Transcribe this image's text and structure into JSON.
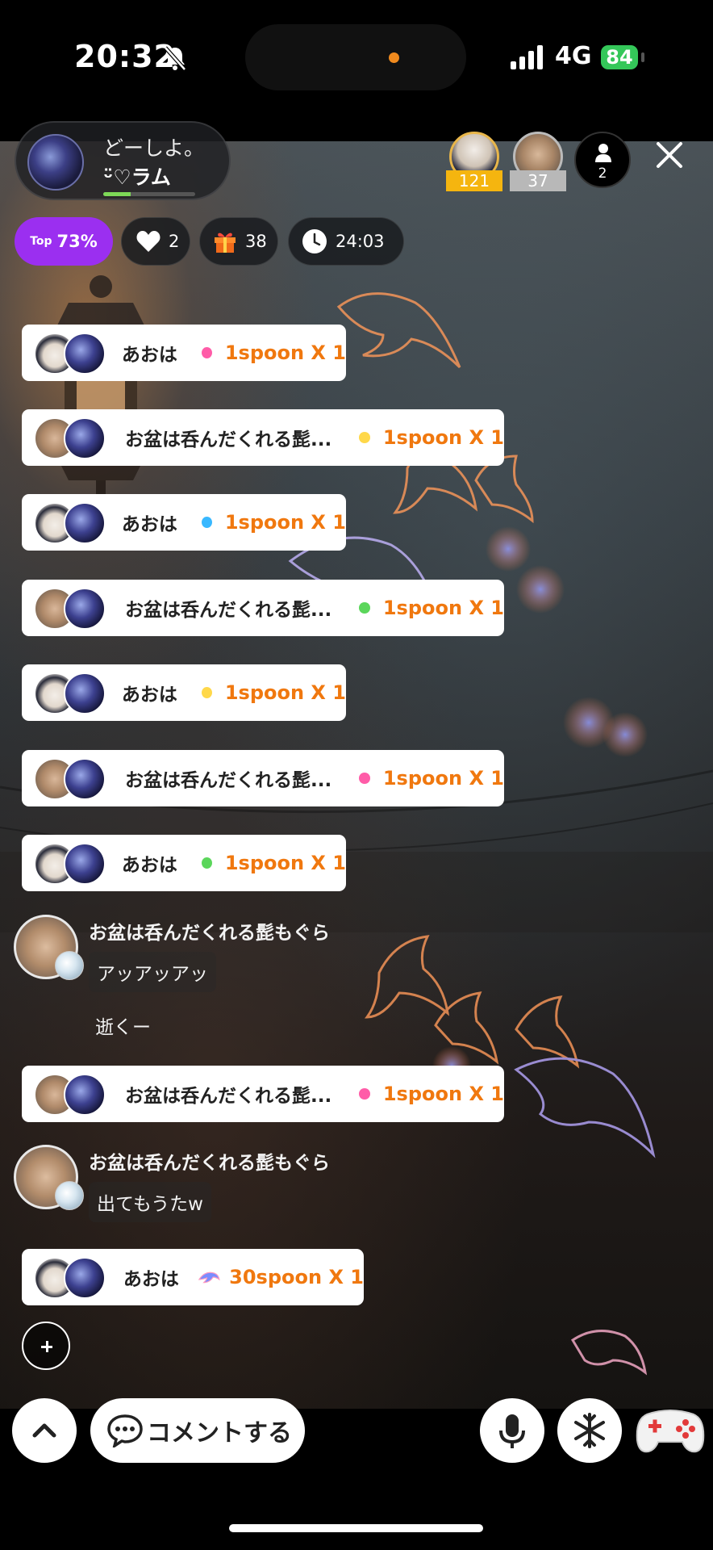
{
  "status_bar": {
    "time": "20:32",
    "network": "4G",
    "battery": "84",
    "icons": [
      "bell-mute-icon",
      "signal-icon",
      "battery-charging-icon"
    ],
    "island_dot_color": "#f08a1e"
  },
  "host": {
    "title": "どーしよ。",
    "name": "ᵕ̈♡ラム",
    "level_progress": 0.3
  },
  "ranking": [
    {
      "rank": 1,
      "count": "121",
      "badge_color": "#f5b50f"
    },
    {
      "rank": 2,
      "count": "37",
      "badge_color": "#b8b8b8"
    }
  ],
  "viewers": {
    "count": "2"
  },
  "stats": {
    "top_label": "Top",
    "top_percent": "73%",
    "likes": "2",
    "gifts": "38",
    "duration": "24:03"
  },
  "feed": {
    "gift_rows": [
      {
        "name": "あおは",
        "amount": "1spoon X 1",
        "spark_color": "#ff5ca8",
        "avatar": "boy"
      },
      {
        "name": "お盆は呑んだくれる髭...",
        "amount": "1spoon X 1",
        "spark_color": "#ffd84a",
        "avatar": "hamster"
      },
      {
        "name": "あおは",
        "amount": "1spoon X 1",
        "spark_color": "#39b8ff",
        "avatar": "boy"
      },
      {
        "name": "お盆は呑んだくれる髭...",
        "amount": "1spoon X 1",
        "spark_color": "#5bd65b",
        "avatar": "hamster"
      },
      {
        "name": "あおは",
        "amount": "1spoon X 1",
        "spark_color": "#ffd84a",
        "avatar": "boy"
      },
      {
        "name": "お盆は呑んだくれる髭...",
        "amount": "1spoon X 1",
        "spark_color": "#ff5ca8",
        "avatar": "hamster"
      },
      {
        "name": "あおは",
        "amount": "1spoon X 1",
        "spark_color": "#5bd65b",
        "avatar": "boy"
      },
      {
        "name": "お盆は呑んだくれる髭...",
        "amount": "1spoon X 1",
        "spark_color": "#ff5ca8",
        "avatar": "hamster"
      },
      {
        "name": "あおは",
        "amount": "30spoon X 1",
        "spark_color": "#7a8cff",
        "avatar": "boy"
      }
    ],
    "chat_1": {
      "name": "お盆は呑んだくれる髭もぐら",
      "message_1": "アッアッアッ",
      "message_2": "逝くー"
    },
    "chat_2": {
      "name": "お盆は呑んだくれる髭もぐら",
      "message_1": "出てもうたw"
    }
  },
  "bottom_bar": {
    "comment_label": "コメントする",
    "icons": [
      "chevron-up-icon",
      "chat-bubble-icon",
      "mic-icon",
      "snowflake-icon",
      "gamepad-icon"
    ]
  }
}
